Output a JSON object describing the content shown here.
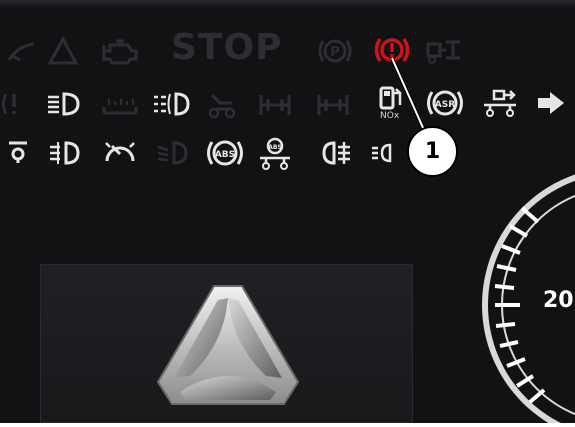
{
  "dashboard": {
    "stop_label": "STOP",
    "nox_label": "NOx",
    "speedometer_tick_label": "20",
    "callout_number": "1",
    "lamps_row1": [
      "wiper-icon",
      "warning-triangle-icon",
      "engine-check-icon",
      "parking-brake-p-icon",
      "brake-warning-icon",
      "trailer-lift-icon"
    ],
    "lamps_row2": [
      "brake-pad-icon",
      "high-beam-icon",
      "preheat-icon",
      "fog-light-icon",
      "trailer-axle-icon",
      "axle-lift-icon",
      "axle-lift-2-icon",
      "adblue-nox-icon",
      "asr-icon",
      "trailer-connect-icon",
      "turn-signal-right-icon"
    ],
    "lamps_row3": [
      "tire-pressure-icon",
      "rear-fog-light-icon",
      "speed-limiter-icon",
      "low-beam-icon",
      "abs-icon",
      "trailer-abs-icon",
      "rear-fog-2-icon",
      "position-lights-icon"
    ],
    "colors": {
      "background": "#111214",
      "inactive_lamp": "#2d2e31",
      "active_white": "#e6e6e6",
      "warning_red": "#d0121b"
    }
  }
}
